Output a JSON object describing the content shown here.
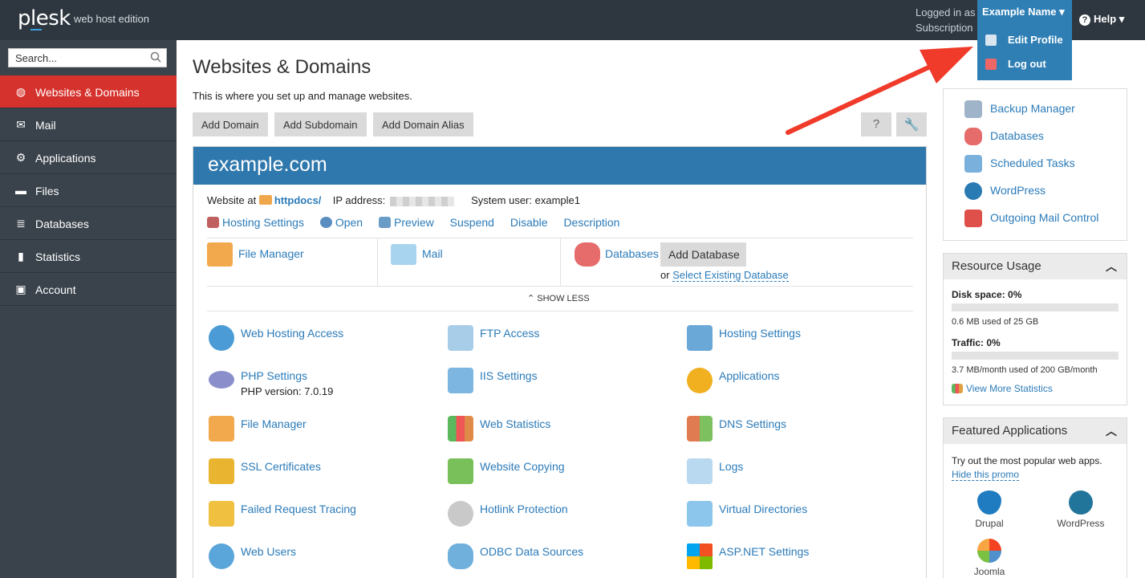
{
  "topbar": {
    "logo": "plesk",
    "edition": "web host edition",
    "logged_in_as": "Logged in as",
    "subscription": "Subscription",
    "user_name": "Example Name",
    "help": "Help",
    "dropdown": {
      "edit_profile": "Edit Profile",
      "log_out": "Log out"
    }
  },
  "sidebar": {
    "search_placeholder": "Search...",
    "items": [
      {
        "label": "Websites & Domains",
        "icon": "globe-icon",
        "active": true
      },
      {
        "label": "Mail",
        "icon": "mail-icon"
      },
      {
        "label": "Applications",
        "icon": "gear-icon"
      },
      {
        "label": "Files",
        "icon": "folder-icon"
      },
      {
        "label": "Databases",
        "icon": "database-icon"
      },
      {
        "label": "Statistics",
        "icon": "bar-chart-icon"
      },
      {
        "label": "Account",
        "icon": "account-icon"
      }
    ]
  },
  "main": {
    "title": "Websites & Domains",
    "description": "This is where you set up and manage websites.",
    "buttons": {
      "add_domain": "Add Domain",
      "add_subdomain": "Add Subdomain",
      "add_alias": "Add Domain Alias"
    },
    "tools": {
      "help": "?",
      "settings": "🔧"
    },
    "domain": {
      "name": "example.com",
      "website_at": "Website at",
      "docroot": "httpdocs/",
      "ip_label": "IP address:",
      "sysuser_label": "System user:",
      "sysuser": "example1",
      "links": {
        "hosting_settings": "Hosting Settings",
        "open": "Open",
        "preview": "Preview",
        "suspend": "Suspend",
        "disable": "Disable",
        "description": "Description"
      },
      "quick": {
        "file_manager": "File Manager",
        "mail": "Mail",
        "databases": "Databases",
        "add_database": "Add Database",
        "or": "or",
        "select_existing": "Select Existing Database"
      },
      "show_less": "SHOW LESS",
      "features": {
        "web_hosting_access": "Web Hosting Access",
        "ftp_access": "FTP Access",
        "hosting_settings": "Hosting Settings",
        "php_settings": "PHP Settings",
        "php_version": "PHP version: 7.0.19",
        "iis_settings": "IIS Settings",
        "applications": "Applications",
        "file_manager": "File Manager",
        "web_statistics": "Web Statistics",
        "dns_settings": "DNS Settings",
        "ssl_certificates": "SSL Certificates",
        "website_copying": "Website Copying",
        "logs": "Logs",
        "failed_request_tracing": "Failed Request Tracing",
        "hotlink_protection": "Hotlink Protection",
        "virtual_directories": "Virtual Directories",
        "web_users": "Web Users",
        "odbc_data_sources": "ODBC Data Sources",
        "aspnet_settings": "ASP.NET Settings"
      }
    }
  },
  "right": {
    "quick_links": {
      "backup_manager": "Backup Manager",
      "databases": "Databases",
      "scheduled_tasks": "Scheduled Tasks",
      "wordpress": "WordPress",
      "outgoing_mail": "Outgoing Mail Control"
    },
    "resource_usage": {
      "title": "Resource Usage",
      "disk_label": "Disk space: 0%",
      "disk_percent": 0,
      "disk_text": "0.6 MB used of 25 GB",
      "traffic_label": "Traffic: 0%",
      "traffic_percent": 0,
      "traffic_text": "3.7 MB/month used of 200 GB/month",
      "more_stats": "View More Statistics"
    },
    "featured": {
      "title": "Featured Applications",
      "text": "Try out the most popular web apps.",
      "hide": "Hide this promo",
      "apps": {
        "drupal": "Drupal",
        "wordpress": "WordPress",
        "joomla": "Joomla"
      }
    }
  },
  "colors": {
    "topbar": "#2e3740",
    "sidebar": "#3a434c",
    "active": "#d6322d",
    "accent": "#2f78ad",
    "link": "#2b7bb9",
    "annotation_arrow": "#f03a2a"
  }
}
